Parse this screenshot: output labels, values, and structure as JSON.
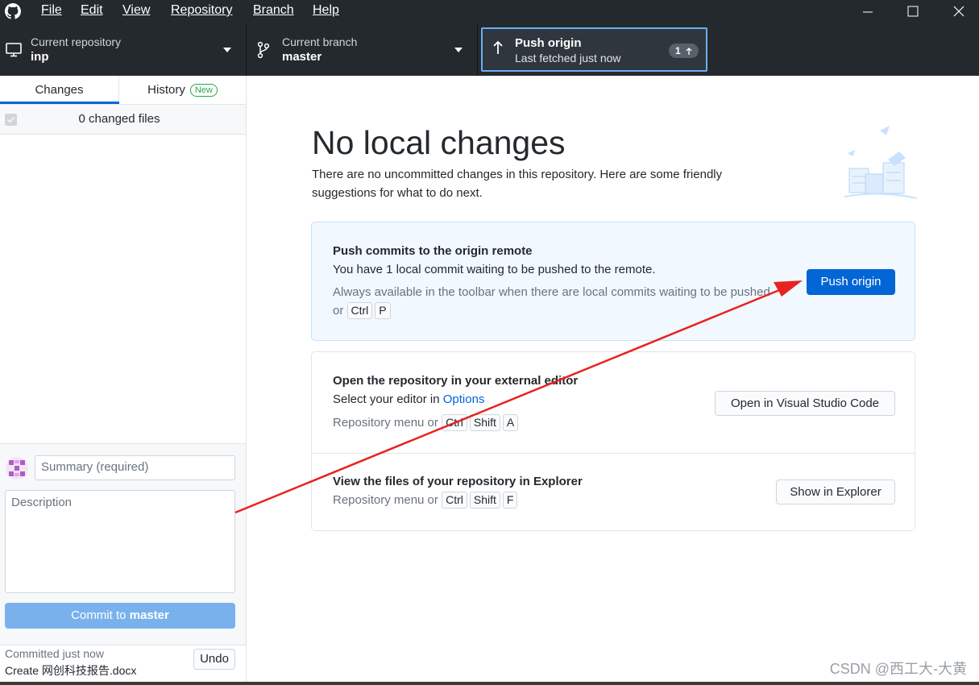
{
  "menu": {
    "file": "File",
    "edit": "Edit",
    "view": "View",
    "repository": "Repository",
    "branch": "Branch",
    "help": "Help"
  },
  "toolbar": {
    "repo_title": "Current repository",
    "repo_value": "inp",
    "branch_title": "Current branch",
    "branch_value": "master",
    "push_title": "Push origin",
    "push_subtitle": "Last fetched just now",
    "push_count": "1"
  },
  "sidebar": {
    "tab_changes": "Changes",
    "tab_history": "History",
    "history_badge": "New",
    "changed_files": "0 changed files",
    "summary_placeholder": "Summary (required)",
    "description_placeholder": "Description",
    "commit_prefix": "Commit to ",
    "commit_branch": "master",
    "last_commit_time": "Committed just now",
    "last_commit_message": "Create 网创科技报告.docx",
    "undo_label": "Undo"
  },
  "main": {
    "heading": "No local changes",
    "lead": "There are no uncommitted changes in this repository. Here are some friendly suggestions for what to do next.",
    "push_card": {
      "title": "Push commits to the origin remote",
      "text": "You have 1 local commit waiting to be pushed to the remote.",
      "hint": "Always available in the toolbar when there are local commits waiting to be pushed or",
      "keys": [
        "Ctrl",
        "P"
      ],
      "button": "Push origin"
    },
    "editor_card": {
      "title": "Open the repository in your external editor",
      "text_prefix": "Select your editor in ",
      "text_link": "Options",
      "hint": "Repository menu or",
      "keys": [
        "Ctrl",
        "Shift",
        "A"
      ],
      "button": "Open in Visual Studio Code"
    },
    "explorer_card": {
      "title": "View the files of your repository in Explorer",
      "hint": "Repository menu or",
      "keys": [
        "Ctrl",
        "Shift",
        "F"
      ],
      "button": "Show in Explorer"
    }
  },
  "watermark": "CSDN @西工大-大黄",
  "colors": {
    "chrome": "#24292e",
    "accent": "#0366d6",
    "annotation_arrow": "#e8231f"
  }
}
